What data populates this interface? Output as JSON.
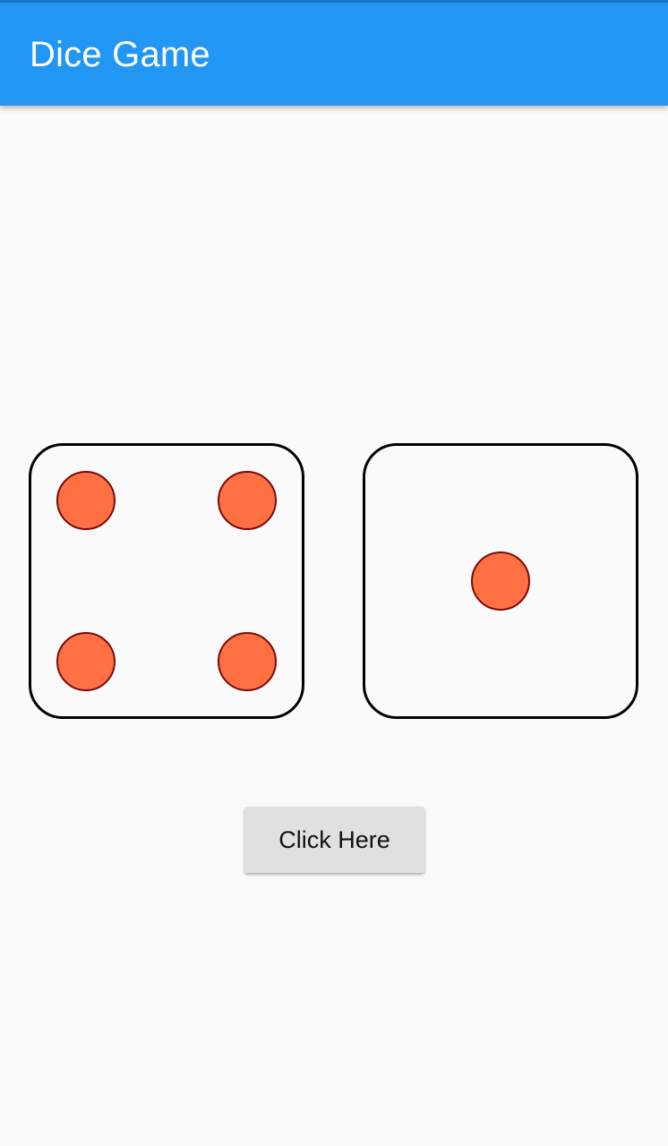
{
  "app_bar": {
    "title": "Dice Game",
    "color": "#2196f3"
  },
  "dice": [
    {
      "value": 4
    },
    {
      "value": 1
    }
  ],
  "pip_color": "#ff7043",
  "button": {
    "label": "Click Here"
  }
}
